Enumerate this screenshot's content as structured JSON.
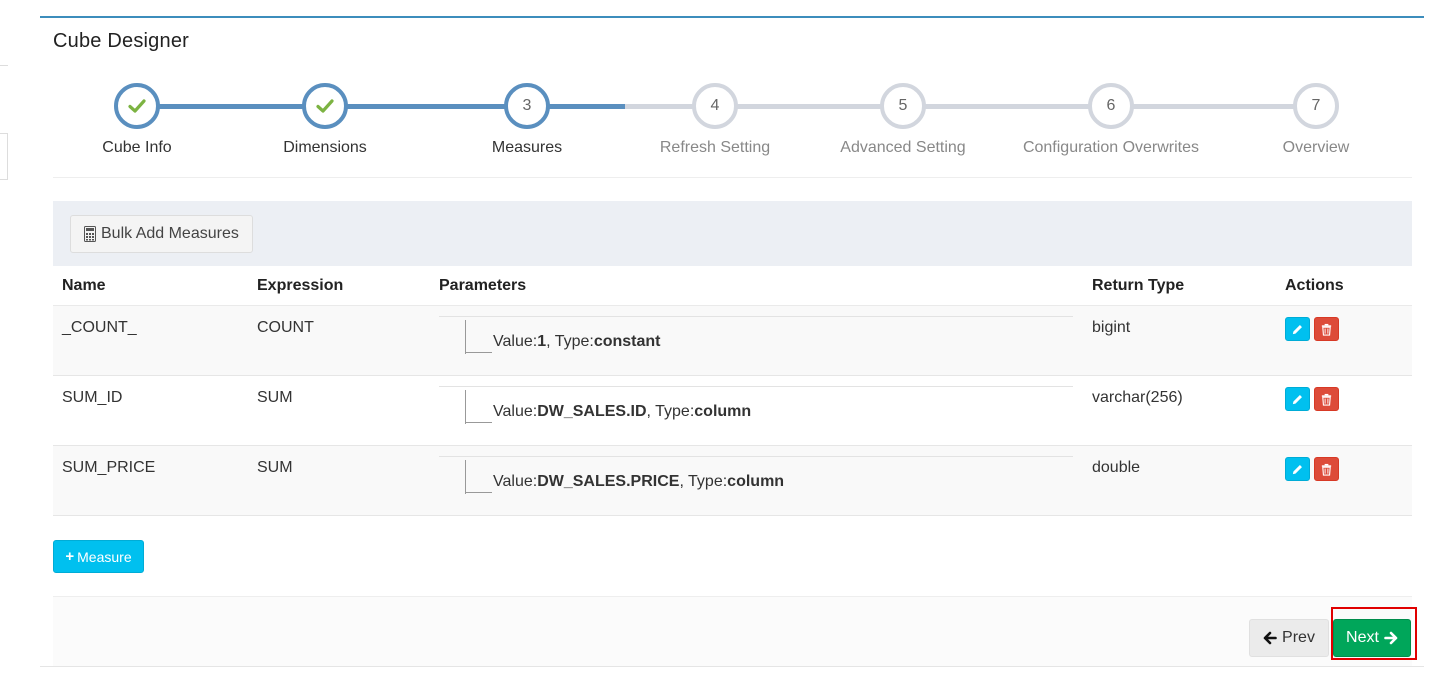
{
  "app": {
    "title": "Cube Designer"
  },
  "wizard": {
    "steps": [
      {
        "label": "Cube Info",
        "number": "1",
        "state": "done"
      },
      {
        "label": "Dimensions",
        "number": "2",
        "state": "done"
      },
      {
        "label": "Measures",
        "number": "3",
        "state": "active"
      },
      {
        "label": "Refresh Setting",
        "number": "4",
        "state": "todo"
      },
      {
        "label": "Advanced Setting",
        "number": "5",
        "state": "todo"
      },
      {
        "label": "Configuration Overwrites",
        "number": "6",
        "state": "todo"
      },
      {
        "label": "Overview",
        "number": "7",
        "state": "todo"
      }
    ]
  },
  "toolbar": {
    "bulk_add_label": "Bulk Add Measures"
  },
  "table": {
    "headers": {
      "name": "Name",
      "expression": "Expression",
      "parameters": "Parameters",
      "return_type": "Return Type",
      "actions": "Actions"
    },
    "param_labels": {
      "value": "Value:",
      "type": ", Type:"
    },
    "rows": [
      {
        "name": "_COUNT_",
        "expression": "COUNT",
        "param_value": "1",
        "param_type": "constant",
        "return_type": "bigint"
      },
      {
        "name": "SUM_ID",
        "expression": "SUM",
        "param_value": "DW_SALES.ID",
        "param_type": "column",
        "return_type": "varchar(256)"
      },
      {
        "name": "SUM_PRICE",
        "expression": "SUM",
        "param_value": "DW_SALES.PRICE",
        "param_type": "column",
        "return_type": "double"
      }
    ]
  },
  "actions": {
    "add_measure_label": "Measure",
    "prev_label": "Prev",
    "next_label": "Next"
  },
  "colors": {
    "accent": "#3c8dbc",
    "progress": "#5a8fbf",
    "check": "#7cb342",
    "info": "#00c0ef",
    "danger": "#dd4b39",
    "success": "#00a65a",
    "highlight": "#e00000"
  }
}
